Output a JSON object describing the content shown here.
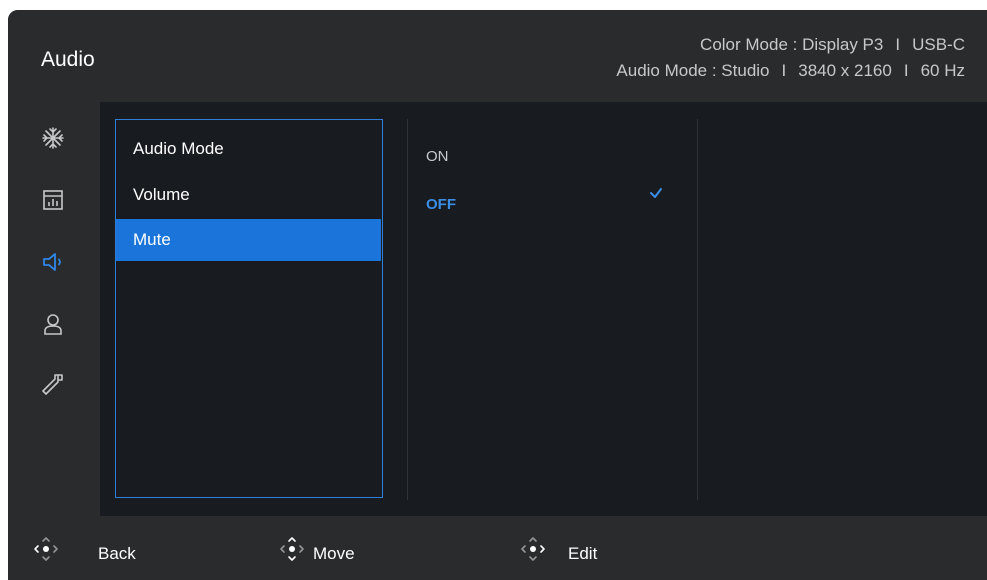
{
  "header": {
    "title": "Audio",
    "color_mode_label": "Color Mode : Display P3",
    "input_label": "USB-C",
    "audio_mode_label": "Audio Mode : Studio",
    "resolution_label": "3840 x 2160",
    "refresh_label": "60 Hz",
    "separator": "I"
  },
  "sidebar": {
    "icons": [
      "picture-quality-icon",
      "display-icon",
      "audio-icon",
      "user-icon",
      "system-wrench-icon"
    ],
    "active_index": 2
  },
  "menu": {
    "items": [
      {
        "label": "Audio Mode"
      },
      {
        "label": "Volume"
      },
      {
        "label": "Mute"
      }
    ],
    "selected_index": 2
  },
  "options": {
    "items": [
      {
        "label": "ON"
      },
      {
        "label": "OFF"
      }
    ],
    "selected_index": 1
  },
  "footer": {
    "back_label": "Back",
    "move_label": "Move",
    "edit_label": "Edit"
  },
  "colors": {
    "accent": "#1a74d9",
    "selected_text": "#3a8ee6"
  }
}
